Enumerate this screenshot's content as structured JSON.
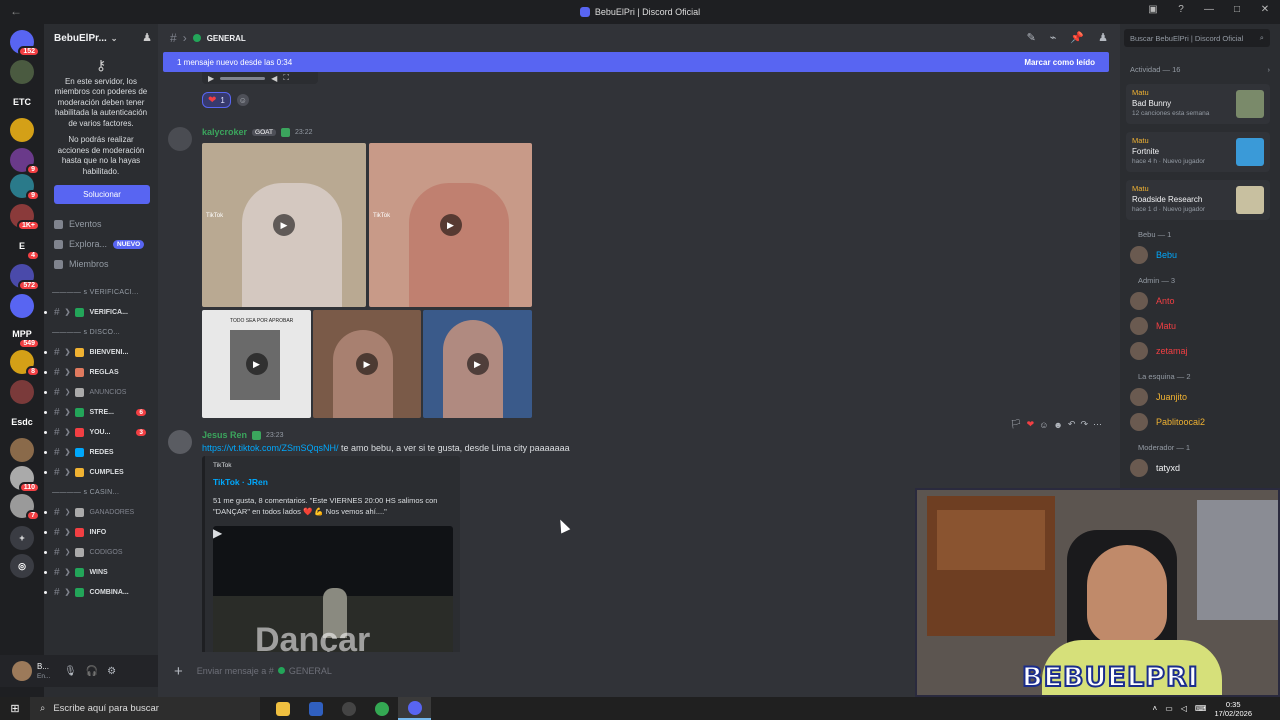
{
  "window": {
    "title": "BebuElPri | Discord Oficial"
  },
  "servers": [
    {
      "label": "",
      "badge": "152",
      "color": "#5865f2"
    },
    {
      "label": "",
      "badge": "",
      "color": "#4a5a40"
    },
    {
      "label": "ETC",
      "badge": "",
      "color": ""
    },
    {
      "label": "",
      "badge": "",
      "color": "#d4a017"
    },
    {
      "label": "",
      "badge": "9",
      "color": "#6a3a8a"
    },
    {
      "label": "",
      "badge": "9",
      "color": "#2a7a8a"
    },
    {
      "label": "",
      "badge": "1K+",
      "color": "#8a3a3a"
    },
    {
      "label": "E",
      "badge": "4",
      "color": ""
    },
    {
      "label": "",
      "badge": "572",
      "color": "#4a4aaa"
    },
    {
      "label": "",
      "badge": "",
      "color": "#5865f2"
    },
    {
      "label": "MPP",
      "badge": "549",
      "color": ""
    },
    {
      "label": "",
      "badge": "8",
      "color": "#d4a017"
    },
    {
      "label": "",
      "badge": "",
      "color": "#7a3a3a"
    },
    {
      "label": "Esdc",
      "badge": "",
      "color": ""
    },
    {
      "label": "",
      "badge": "",
      "color": "#8a6a4a"
    },
    {
      "label": "",
      "badge": "110",
      "color": "#aaaaaa"
    },
    {
      "label": "",
      "badge": "7",
      "color": "#9a9a9a"
    }
  ],
  "server": {
    "name": "BebuElPr...",
    "notice_1": "En este servidor, los miembros con poderes de moderación deben tener habilitada la autenticación de varios factores.",
    "notice_2": "No podrás realizar acciones de moderación hasta que no la hayas habilitado.",
    "fix_button": "Solucionar",
    "nav": [
      {
        "label": "Eventos",
        "badge": ""
      },
      {
        "label": "Explora...",
        "badge": "NUEVO"
      },
      {
        "label": "Miembros",
        "badge": ""
      }
    ],
    "channels": [
      {
        "type": "cat",
        "label": "———— ꜱ VERIFICACI..."
      },
      {
        "type": "ch",
        "label": "VERIFICA...",
        "emo": "#23a559",
        "badge": "",
        "dim": false
      },
      {
        "type": "cat",
        "label": "———— ꜱ DISCO..."
      },
      {
        "type": "ch",
        "label": "BIENVENI...",
        "emo": "#f0b232",
        "badge": "",
        "dim": false
      },
      {
        "type": "ch",
        "label": "REGLAS",
        "emo": "#e07a5f",
        "badge": "",
        "dim": false
      },
      {
        "type": "ch",
        "label": "ANUNCIOS",
        "emo": "#aaaaaa",
        "badge": "",
        "dim": true
      },
      {
        "type": "ch",
        "label": "STRE...",
        "emo": "#23a559",
        "badge": "6",
        "dim": false
      },
      {
        "type": "ch",
        "label": "YOU...",
        "emo": "#f23f43",
        "badge": "3",
        "dim": false
      },
      {
        "type": "ch",
        "label": "REDES",
        "emo": "#00a8fc",
        "badge": "",
        "dim": false
      },
      {
        "type": "ch",
        "label": "CUMPLES",
        "emo": "#f0b232",
        "badge": "",
        "dim": false
      },
      {
        "type": "cat",
        "label": "———— ꜱ CASIN..."
      },
      {
        "type": "ch",
        "label": "GANADORES",
        "emo": "#aaaaaa",
        "badge": "",
        "dim": true
      },
      {
        "type": "ch",
        "label": "INFO",
        "emo": "#f23f43",
        "badge": "",
        "dim": false
      },
      {
        "type": "ch",
        "label": "CODIGOS",
        "emo": "#aaaaaa",
        "badge": "",
        "dim": true
      },
      {
        "type": "ch",
        "label": "WINS",
        "emo": "#23a559",
        "badge": "",
        "dim": false
      },
      {
        "type": "ch",
        "label": "COMBINA...",
        "emo": "#23a559",
        "badge": "",
        "dim": false
      }
    ]
  },
  "user": {
    "name": "B...",
    "status": "En..."
  },
  "channel": {
    "name": "GENERAL"
  },
  "newbar": {
    "text": "1 mensaje nuevo desde las 0:34",
    "mark": "Marcar como leído"
  },
  "reaction": {
    "count": "1"
  },
  "messages": [
    {
      "author": "kalycroker",
      "tag": "GOAT",
      "time": "23:22",
      "tiktok_labels": [
        "TikTok",
        "TikTok",
        "TODO SEA POR APROBAR"
      ]
    },
    {
      "author": "Jesus Ren",
      "time": "23:23",
      "link": "https://vt.tiktok.com/ZSmSQqsNH/",
      "text": " te amo bebu, a ver si te gusta, desde Lima city paaaaaaa",
      "embed": {
        "provider": "TikTok",
        "title": "TikTok · JRen",
        "description": "51 me gusta, 8 comentarios. \"Este VIERNES 20:00 HS salimos con \"DANÇAR\" en todos lados ❤️ 💪 Nos vemos ahí....\"",
        "img_text": "Dançar"
      }
    }
  ],
  "composer": {
    "placeholder": "Enviar mensaje a #",
    "channel": "GENERAL"
  },
  "right": {
    "search_placeholder": "Buscar BebuElPri | Discord Oficial",
    "activity_header": "Actividad — 16",
    "activities": [
      {
        "user": "Matu",
        "game": "Bad Bunny",
        "meta": "12 canciones esta semana"
      },
      {
        "user": "Matu",
        "game": "Fortnite",
        "meta": "hace 4 h  ·  Nuevo jugador"
      },
      {
        "user": "Matu",
        "game": "Roadside Research",
        "meta": "hace 1 d  ·  Nuevo jugador"
      }
    ],
    "groups": [
      {
        "label": "Bebu — 1",
        "members": [
          {
            "name": "Bebu",
            "color": "#00a8fc"
          }
        ]
      },
      {
        "label": "Admin — 3",
        "members": [
          {
            "name": "Anto",
            "color": "#f23f43"
          },
          {
            "name": "Matu",
            "color": "#f23f43"
          },
          {
            "name": "zetamaj",
            "color": "#f23f43"
          }
        ]
      },
      {
        "label": "La esquina — 2",
        "members": [
          {
            "name": "Juanjito",
            "color": "#f0b232"
          },
          {
            "name": "Pablitoocai2",
            "color": "#f0b232"
          }
        ]
      },
      {
        "label": "Moderador — 1",
        "members": [
          {
            "name": "tatyxd",
            "color": "#f2f3f5"
          }
        ]
      }
    ]
  },
  "stream_overlay": {
    "logo": "BEBUELPRI"
  },
  "taskbar": {
    "search": "Escribe aquí para buscar",
    "time": "0:35",
    "date": "17/02/2026"
  }
}
